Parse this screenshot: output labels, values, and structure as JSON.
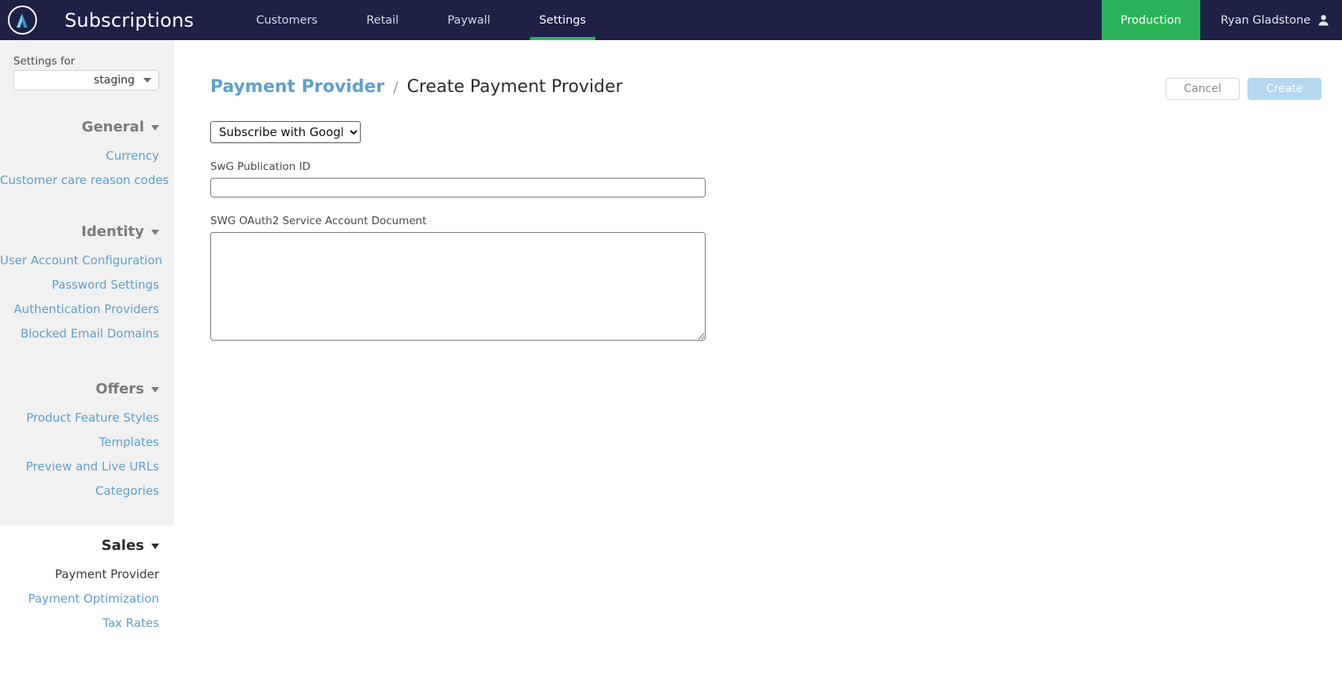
{
  "topnav": {
    "logo_icon": "apex-a-logo-icon",
    "app_title": "Subscriptions",
    "items": [
      {
        "label": "Customers",
        "active": false
      },
      {
        "label": "Retail",
        "active": false
      },
      {
        "label": "Paywall",
        "active": false
      },
      {
        "label": "Settings",
        "active": true
      }
    ],
    "environment_badge": "Production",
    "user_name": "Ryan Gladstone",
    "user_icon": "person-icon",
    "accent_green": "#2cb35a",
    "nav_background": "#1e2045"
  },
  "sidebar": {
    "settings_for_label": "Settings for",
    "environment_value": "staging",
    "groups": [
      {
        "title": "General",
        "links": [
          {
            "label": "Currency",
            "current": false
          },
          {
            "label": "Customer care reason codes",
            "current": false
          }
        ]
      },
      {
        "title": "Identity",
        "links": [
          {
            "label": "User Account Configuration",
            "current": false
          },
          {
            "label": "Password Settings",
            "current": false
          },
          {
            "label": "Authentication Providers",
            "current": false
          },
          {
            "label": "Blocked Email Domains",
            "current": false
          }
        ]
      },
      {
        "title": "Offers",
        "links": [
          {
            "label": "Product Feature Styles",
            "current": false
          },
          {
            "label": "Templates",
            "current": false
          },
          {
            "label": "Preview and Live URLs",
            "current": false
          },
          {
            "label": "Categories",
            "current": false
          }
        ]
      },
      {
        "title": "Sales",
        "links": [
          {
            "label": "Payment Provider",
            "current": true
          },
          {
            "label": "Payment Optimization",
            "current": false
          },
          {
            "label": "Tax Rates",
            "current": false
          }
        ]
      }
    ],
    "link_color": "#5ea0cc",
    "background": "#f1f1f1"
  },
  "main": {
    "breadcrumb_parent": "Payment Provider",
    "breadcrumb_separator": "/",
    "breadcrumb_current": "Create Payment Provider",
    "cancel_label": "Cancel",
    "create_label": "Create",
    "create_disabled_color": "#b5d7ef",
    "provider_select": {
      "selected": "Subscribe with Google",
      "options": [
        "Subscribe with Google"
      ]
    },
    "fields": [
      {
        "label": "SwG Publication ID",
        "value": "",
        "placeholder": ""
      },
      {
        "label": "SWG OAuth2 Service Account Document",
        "value": "",
        "placeholder": ""
      }
    ]
  }
}
